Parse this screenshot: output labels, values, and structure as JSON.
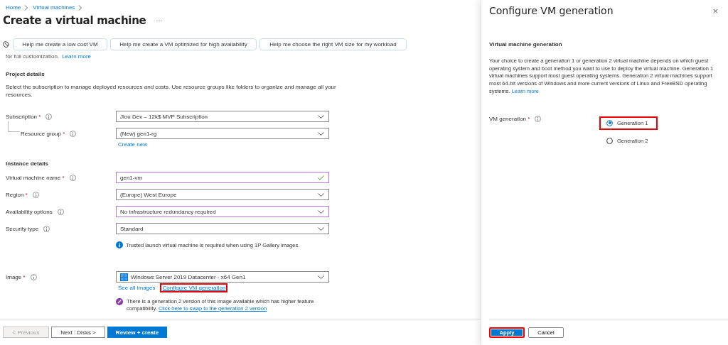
{
  "breadcrumb": [
    "Home",
    "Virtual machines"
  ],
  "title": "Create a virtual machine",
  "more": "···",
  "required_mark": "*",
  "assist_buttons": [
    "Help me create a low cost VM",
    "Help me create a VM optimized for high availability",
    "Help me choose the right VM size for my workload"
  ],
  "intro": {
    "text": "for full customization.",
    "link": "Learn more"
  },
  "project_details": {
    "heading": "Project details",
    "description": "Select the subscription to manage deployed resources and costs. Use resource groups like folders to organize and manage all your resources."
  },
  "project_fields": [
    {
      "kind": "dropdown",
      "label": "Subscription",
      "required": true,
      "nested": false,
      "value": "Jlou Dev – 12k$ MVP Subscription",
      "edited": false
    },
    {
      "kind": "dropdown",
      "label": "Resource group",
      "required": true,
      "nested": true,
      "value": "(New) gen1-rg",
      "edited": false,
      "links": [
        {
          "text": "Create new",
          "highlighted": false
        }
      ]
    }
  ],
  "instance_details": {
    "heading": "Instance details"
  },
  "instance_fields": [
    {
      "kind": "text",
      "label": "Virtual machine name",
      "required": true,
      "nested": false,
      "value": "gen1-vm",
      "edited": true,
      "valid": true
    },
    {
      "kind": "dropdown",
      "label": "Region",
      "required": true,
      "nested": false,
      "value": "(Europe) West Europe",
      "edited": false
    },
    {
      "kind": "dropdown",
      "label": "Availability options",
      "required": false,
      "nested": false,
      "value": "No infrastructure redundancy required",
      "edited": true
    },
    {
      "kind": "dropdown",
      "label": "Security type",
      "required": false,
      "nested": false,
      "value": "Standard",
      "edited": false,
      "info": "Trusted launch virtual machine is required when using 1P Gallery images."
    },
    {
      "kind": "image",
      "label": "Image",
      "required": true,
      "nested": false,
      "value": "Windows Server 2019 Datacenter - x64 Gen1",
      "edited": false,
      "links": [
        {
          "text": "See all images",
          "highlighted": false
        },
        {
          "text": "Configure VM generation",
          "highlighted": true
        }
      ],
      "note": {
        "text": "There is a generation 2 version of this image available which has higher feature compatibility.",
        "link": "Click here to swap to the generation 2 version"
      }
    }
  ],
  "footer_buttons": [
    {
      "label": "< Previous",
      "kind": "secondary",
      "disabled": true
    },
    {
      "label": "Next : Disks >",
      "kind": "secondary",
      "disabled": false
    },
    {
      "label": "Review + create",
      "kind": "primary",
      "disabled": false
    }
  ],
  "panel": {
    "title": "Configure VM generation",
    "close": "×",
    "heading": "Virtual machine generation",
    "description": "Your choice to create a generation 1 or generation 2 virtual machine depends on which guest operating system and boot method you want to use to deploy the virtual machine. Generation 1 virtual machines support most guest operating systems. Generation 2 virtual machines support most 64-bit versions of Windows and more current versions of Linux and FreeBSD operating systems.",
    "learn_more": "Learn more",
    "field_label": "VM generation",
    "required": true,
    "options": [
      {
        "label": "Generation 1",
        "selected": true,
        "highlighted": true
      },
      {
        "label": "Generation 2",
        "selected": false,
        "highlighted": false
      }
    ],
    "buttons": [
      {
        "label": "Apply",
        "kind": "primary",
        "highlighted": true
      },
      {
        "label": "Cancel",
        "kind": "secondary",
        "highlighted": false
      }
    ]
  }
}
